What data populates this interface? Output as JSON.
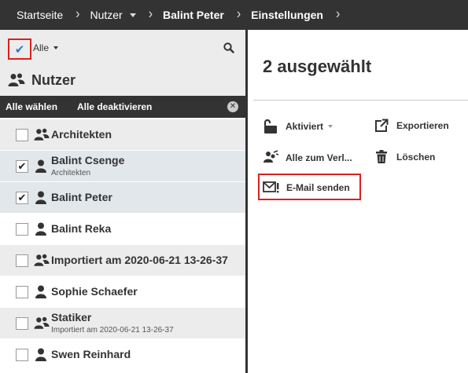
{
  "breadcrumb": {
    "items": [
      {
        "label": "Startseite"
      },
      {
        "label": "Nutzer"
      },
      {
        "label": "Balint Peter"
      },
      {
        "label": "Einstellungen"
      }
    ]
  },
  "filter": {
    "dropdown_label": "Alle"
  },
  "list": {
    "title": "Nutzer",
    "select_all_label": "Alle wählen",
    "deselect_all_label": "Alle deaktivieren",
    "rows": [
      {
        "name": "Architekten",
        "type": "group",
        "checked": false,
        "sub": ""
      },
      {
        "name": "Balint Csenge",
        "type": "user",
        "checked": true,
        "sub": "Architekten"
      },
      {
        "name": "Balint Peter",
        "type": "user",
        "checked": true,
        "sub": ""
      },
      {
        "name": "Balint Reka",
        "type": "user",
        "checked": false,
        "sub": ""
      },
      {
        "name": "Importiert am 2020-06-21 13-26-37",
        "type": "group",
        "checked": false,
        "sub": ""
      },
      {
        "name": "Sophie Schaefer",
        "type": "user",
        "checked": false,
        "sub": ""
      },
      {
        "name": "Statiker",
        "type": "group",
        "checked": false,
        "sub": "Importiert am 2020-06-21 13-26-37"
      },
      {
        "name": "Swen Reinhard",
        "type": "user",
        "checked": false,
        "sub": ""
      }
    ]
  },
  "detail": {
    "title": "2 ausgewählt",
    "actions": {
      "activated": "Aktiviert",
      "export": "Exportieren",
      "all_to_list": "Alle zum Verl...",
      "delete": "Löschen",
      "send_email": "E-Mail senden"
    }
  },
  "colors": {
    "topbar": "#333333",
    "panel_grey": "#ececec",
    "selected_row": "#e2e7eb",
    "highlight_red": "#d9211d",
    "check_blue": "#2b7bbf"
  }
}
